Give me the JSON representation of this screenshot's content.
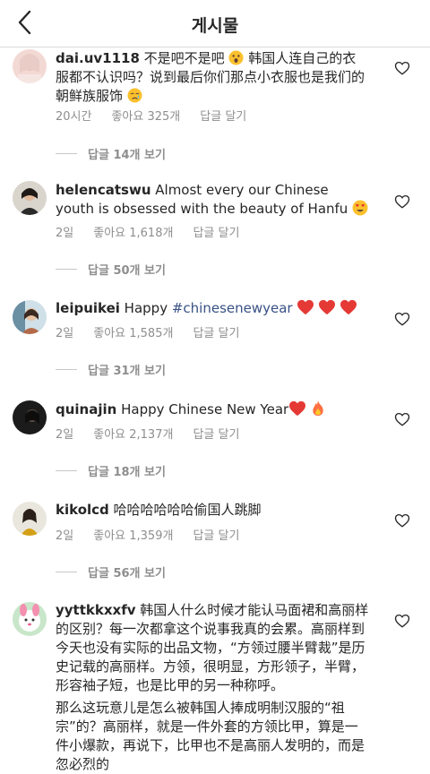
{
  "header": {
    "title": "게시물"
  },
  "comments": [
    {
      "username": "dai.uv1118",
      "text_a": " 不是吧不是吧",
      "text_b": "韩国人连自己的衣服都不认识吗？说到最后你们那点小衣服也是我们的朝鲜族服饰",
      "time": "20시간",
      "likes": "좋아요 325개",
      "reply": "답글 달기",
      "view_replies": "답글 14개 보기"
    },
    {
      "username": "helencatswu",
      "text": " Almost every our Chinese youth is obsessed with the beauty of Hanfu",
      "time": "2일",
      "likes": "좋아요 1,618개",
      "reply": "답글 달기",
      "view_replies": "답글 50개 보기"
    },
    {
      "username": "leipuikei",
      "text": " Happy ",
      "hashtag": "#chinesenewyear",
      "time": "2일",
      "likes": "좋아요 1,585개",
      "reply": "답글 달기",
      "view_replies": "답글 31개 보기"
    },
    {
      "username": "quinajin",
      "text": " Happy Chinese New Year",
      "time": "2일",
      "likes": "좋아요 2,137개",
      "reply": "답글 달기",
      "view_replies": "답글 18개 보기"
    },
    {
      "username": "kikolcd",
      "text": " 哈哈哈哈哈哈偷国人跳脚",
      "time": "2일",
      "likes": "좋아요 1,359개",
      "reply": "답글 달기",
      "view_replies": "답글 56개 보기"
    },
    {
      "username": "yyttkkxxfv",
      "text": " 韩国人什么时候才能认马面裙和高丽样的区别？每一次都拿这个说事我真的会累。高丽样到今天也没有实际的出品文物，“方领过腰半臂裁”是历史记载的高丽样。方领，很明显，方形领子，半臂，形容袖子短，也是比甲的另一种称呼。",
      "text2": "那么这玩意儿是怎么被韩国人捧成明制汉服的“祖宗”的？高丽样，就是一件外套的方领比甲，算是一件小爆款，再说下，比甲也不是高丽人发明的，而是忽必烈的"
    }
  ]
}
